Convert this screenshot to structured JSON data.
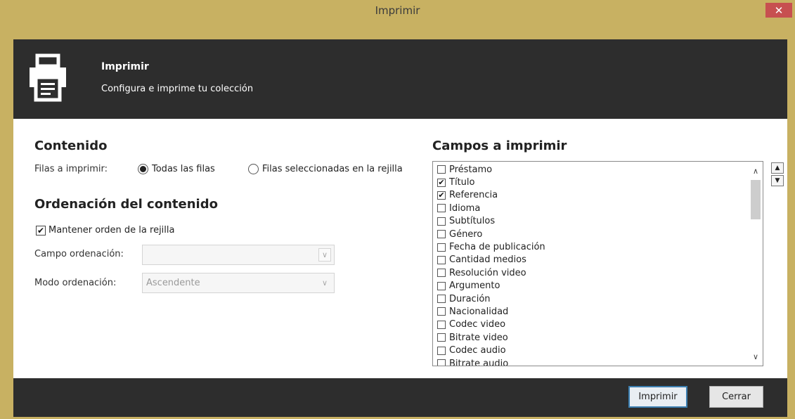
{
  "window": {
    "title": "Imprimir",
    "close_label": "✕"
  },
  "header": {
    "title": "Imprimir",
    "subtitle": "Configura e imprime tu colección"
  },
  "contenido": {
    "title": "Contenido",
    "rows_label": "Filas a imprimir:",
    "radio_all": "Todas las filas",
    "radio_selected": "Filas seleccionadas en la rejilla",
    "selected_option": "Todas las filas"
  },
  "ordenacion": {
    "title": "Ordenación del contenido",
    "keep_order_label": "Mantener orden de la rejilla",
    "keep_order_checked": true,
    "sort_field_label": "Campo ordenación:",
    "sort_field_value": "",
    "sort_mode_label": "Modo ordenación:",
    "sort_mode_value": "Ascendente"
  },
  "campos": {
    "title": "Campos a imprimir",
    "items": [
      {
        "label": "Préstamo",
        "checked": false
      },
      {
        "label": "Título",
        "checked": true
      },
      {
        "label": "Referencia",
        "checked": true
      },
      {
        "label": "Idioma",
        "checked": false
      },
      {
        "label": "Subtítulos",
        "checked": false
      },
      {
        "label": "Género",
        "checked": false
      },
      {
        "label": "Fecha de publicación",
        "checked": false
      },
      {
        "label": "Cantidad medios",
        "checked": false
      },
      {
        "label": "Resolución video",
        "checked": false
      },
      {
        "label": "Argumento",
        "checked": false
      },
      {
        "label": "Duración",
        "checked": false
      },
      {
        "label": "Nacionalidad",
        "checked": false
      },
      {
        "label": "Codec video",
        "checked": false
      },
      {
        "label": "Bitrate video",
        "checked": false
      },
      {
        "label": "Codec audio",
        "checked": false
      },
      {
        "label": "Bitrate audio",
        "checked": false
      }
    ]
  },
  "buttons": {
    "print": "Imprimir",
    "close": "Cerrar"
  },
  "colors": {
    "title_bar": "#c8b162",
    "header_bg": "#2d2d2d",
    "close_btn": "#c75050",
    "primary_border": "#3c7fb1"
  }
}
